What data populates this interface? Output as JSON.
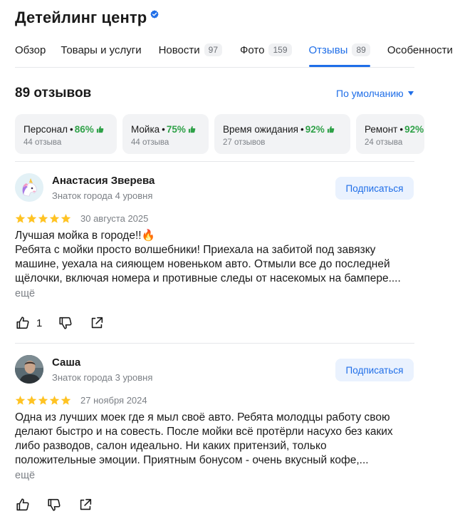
{
  "business": {
    "title": "Детейлинг центр"
  },
  "tabs": [
    {
      "label": "Обзор",
      "count": ""
    },
    {
      "label": "Товары и услуги",
      "count": ""
    },
    {
      "label": "Новости",
      "count": "97"
    },
    {
      "label": "Фото",
      "count": "159"
    },
    {
      "label": "Отзывы",
      "count": "89"
    },
    {
      "label": "Особенности",
      "count": ""
    }
  ],
  "reviews_header": {
    "count_label": "89 отзывов",
    "sort_label": "По умолчанию"
  },
  "aspects": [
    {
      "name": "Персонал",
      "percent": "86%",
      "count": "44 отзыва"
    },
    {
      "name": "Мойка",
      "percent": "75%",
      "count": "44 отзыва"
    },
    {
      "name": "Время ожидания",
      "percent": "92%",
      "count": "27 отзывов"
    },
    {
      "name": "Ремонт",
      "percent": "92%",
      "count": "24 отзыва"
    }
  ],
  "reviews": [
    {
      "author": "Анастасия Зверева",
      "level": "Знаток города 4 уровня",
      "subscribe_label": "Подписаться",
      "rating": 5,
      "date": "30 августа 2025",
      "lines": [
        "Лучшая мойка в городе!!🔥",
        "Ребята с мойки просто волшебники! Приехала на забитой под завязку",
        "машине, уехала на сияющем новеньком авто. Отмыли все до последней",
        "щёлочки, включая номера и противные следы от насекомых на бампере...."
      ],
      "more_label": "ещё",
      "likes": "1"
    },
    {
      "author": "Саша",
      "level": "Знаток города 3 уровня",
      "subscribe_label": "Подписаться",
      "rating": 5,
      "date": "27 ноября 2024",
      "lines": [
        "Одна из лучших моек где я мыл своё авто. Ребята молодцы работу свою",
        "делают быстро и на совесть. После мойки всё протёрли насухо без каких",
        "либо разводов, салон идеально. Ни каких притензий, только",
        "положительные эмоции. Приятным бонусом - очень вкусный кофе,..."
      ],
      "more_label": "ещё",
      "likes": ""
    }
  ],
  "icons": {
    "verified": "verified-badge-icon",
    "thumb_up": "thumb-up-icon",
    "like": "like-icon",
    "dislike": "dislike-icon",
    "share": "share-icon",
    "star": "star-icon"
  },
  "colors": {
    "accent": "#1f6ee8",
    "positive": "#2fa148",
    "star": "#ffc323",
    "muted": "#7c8086",
    "chip_bg": "#f2f3f5"
  }
}
